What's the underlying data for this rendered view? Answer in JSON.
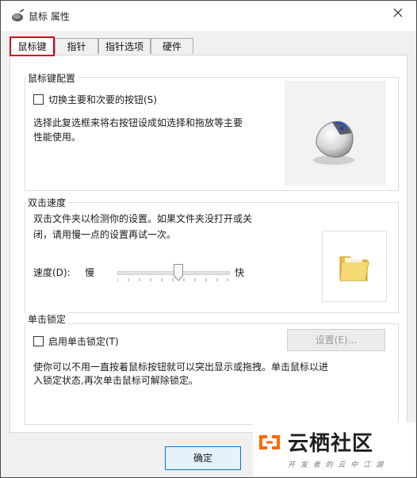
{
  "window": {
    "title": "鼠标 属性"
  },
  "tabs": [
    {
      "label": "鼠标键",
      "active": true
    },
    {
      "label": "指针",
      "active": false
    },
    {
      "label": "指针选项",
      "active": false
    },
    {
      "label": "硬件",
      "active": false
    }
  ],
  "button_config": {
    "group_title": "鼠标键配置",
    "checkbox_label": "切换主要和次要的按钮(S)",
    "checked": false,
    "description_line1": "选择此复选框来将右按钮设成如选择和拖放等主要",
    "description_line2": "性能使用。"
  },
  "double_click": {
    "group_title": "双击速度",
    "description_line1": "双击文件夹以检测你的设置。如果文件夹没打开或关",
    "description_line2": "闭，请用慢一点的设置再试一次。",
    "speed_label": "速度(D):",
    "slow_label": "慢",
    "fast_label": "快",
    "speed_value_fraction": 0.55
  },
  "click_lock": {
    "group_title": "单击锁定",
    "checkbox_label": "启用单击锁定(T)",
    "checked": false,
    "settings_button": "设置(E)...",
    "description_line1": "使你可以不用一直按着鼠标按钮就可以突出显示或拖拽。单击鼠标以进",
    "description_line2": "入锁定状态,再次单击鼠标可解除锁定。"
  },
  "footer": {
    "ok_button": "确定"
  },
  "watermark": {
    "brand": "云栖社区",
    "slogan": "开 发 者 的 云 中 江 湖"
  },
  "colors": {
    "tab_highlight": "#d0021b",
    "dialog_bg": "#f0f0f0"
  },
  "icons": [
    "mouse-pointer-title-icon",
    "close-icon",
    "mouse-illustration-icon",
    "folder-icon",
    "aliyun-logo-icon"
  ]
}
